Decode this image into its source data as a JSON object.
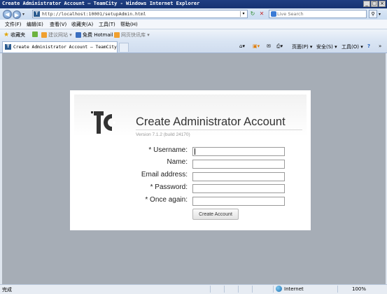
{
  "window": {
    "title": "Create Administrator Account — TeamCity - Windows Internet Explorer",
    "controls": [
      "_",
      "□",
      "×"
    ]
  },
  "addressbar": {
    "url": "http://localhost:10001/setupAdmin.html",
    "search_placeholder": "Live Search"
  },
  "menu": {
    "items": [
      "文件(F)",
      "编辑(E)",
      "查看(V)",
      "收藏夹(A)",
      "工具(T)",
      "帮助(H)"
    ]
  },
  "favorites_bar": {
    "favorites_label": "收藏夹",
    "suggested_sites": "建议网站 ▾",
    "free_hotmail": "免费 Hotmail",
    "web_slice_gallery": "网页快讯库 ▾"
  },
  "tab": {
    "label": "Create Administrator Account — TeamCity"
  },
  "command_bar": {
    "page": "页面(P) ▾",
    "safety": "安全(S) ▾",
    "tools": "工具(O) ▾",
    "help": "?",
    "more": "»"
  },
  "page": {
    "heading": "Create Administrator Account",
    "version": "Version 7.1.2 (build 24170)",
    "logo_text": "TC",
    "fields": [
      {
        "label": "* Username:",
        "value": ""
      },
      {
        "label": "Name:",
        "value": ""
      },
      {
        "label": "Email address:",
        "value": ""
      },
      {
        "label": "* Password:",
        "value": ""
      },
      {
        "label": "* Once again:",
        "value": ""
      }
    ],
    "submit_label": "Create Account"
  },
  "statusbar": {
    "status": "完成",
    "zone": "Internet",
    "zoom": "100%"
  },
  "icons": [
    "back-arrow-icon",
    "forward-arrow-icon",
    "refresh-icon",
    "stop-icon",
    "search-icon",
    "favorites-star-icon",
    "home-icon",
    "feeds-icon",
    "mail-icon",
    "print-icon",
    "globe-icon"
  ]
}
